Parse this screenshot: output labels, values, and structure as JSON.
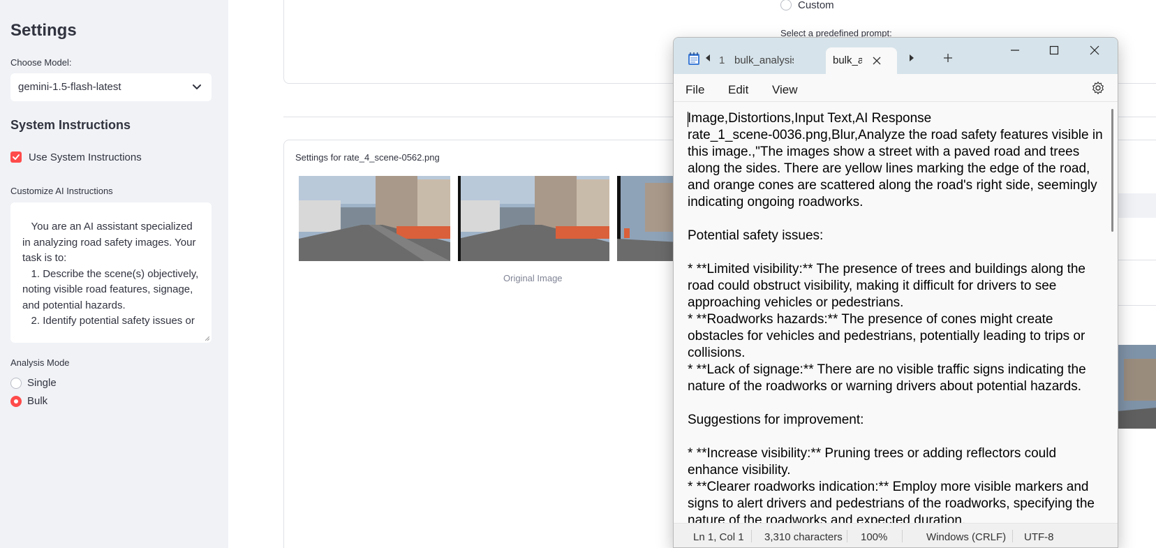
{
  "sidebar": {
    "title": "Settings",
    "model_label": "Choose Model:",
    "model_value": "gemini-1.5-flash-latest",
    "system_heading": "System Instructions",
    "use_system_label": "Use System Instructions",
    "use_system_checked": true,
    "customize_label": "Customize AI Instructions",
    "instructions_text": "   You are an AI assistant specialized in analyzing road safety images. Your task is to:\n   1. Describe the scene(s) objectively, noting visible road features, signage, and potential hazards.\n   2. Identify potential safety issues or",
    "analysis_mode_label": "Analysis Mode",
    "modes": [
      {
        "label": "Single",
        "selected": false
      },
      {
        "label": "Bulk",
        "selected": true
      }
    ]
  },
  "main": {
    "custom_radio_label": "Custom",
    "predefined_prompt_label": "Select a predefined prompt:",
    "settings_title": "Settings for rate_4_scene-0562.png",
    "original_caption": "Original Image"
  },
  "notepad": {
    "tabs": [
      {
        "number": "1",
        "label": "bulk_analysis",
        "active": false
      },
      {
        "label": "bulk_a",
        "active": true
      }
    ],
    "menu": [
      "File",
      "Edit",
      "View"
    ],
    "content": "Image,Distortions,Input Text,AI Response\nrate_1_scene-0036.png,Blur,Analyze the road safety features visible in this image.,\"The images show a street with a paved road and trees along the sides. There are yellow lines marking the edge of the road, and orange cones are scattered along the road's right side, seemingly indicating ongoing roadworks.\n\nPotential safety issues:\n\n* **Limited visibility:** The presence of trees and buildings along the road could obstruct visibility, making it difficult for drivers to see approaching vehicles or pedestrians.\n* **Roadworks hazards:** The presence of cones might create obstacles for vehicles and pedestrians, potentially leading to trips or collisions.\n* **Lack of signage:** There are no visible traffic signs indicating the nature of the roadworks or warning drivers about potential hazards.\n\nSuggestions for improvement:\n\n* **Increase visibility:** Pruning trees or adding reflectors could enhance visibility.\n* **Clearer roadworks indication:** Employ more visible markers and signs to alert drivers and pedestrians of the roadworks, specifying the nature of the roadworks and expected duration.",
    "status": {
      "position": "Ln 1, Col 1",
      "characters": "3,310 characters",
      "zoom": "100%",
      "line_ending": "Windows (CRLF)",
      "encoding": "UTF-8"
    }
  },
  "colors": {
    "accent": "#ff4b4b",
    "sidebar_bg": "#f0f2f6",
    "notepad_titlebar": "#d6e3ea"
  }
}
